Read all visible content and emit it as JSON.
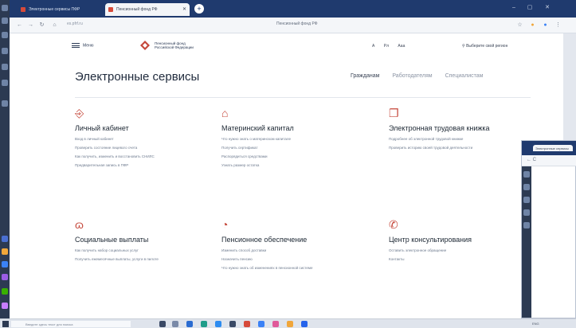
{
  "browser": {
    "tabs": [
      {
        "label": "Электронные сервисы ПФР",
        "active": false
      },
      {
        "label": "Пенсионный фонд РФ",
        "active": true
      }
    ],
    "url": "es.pfrf.ru",
    "page_title": "Пенсионный фонд РФ"
  },
  "site": {
    "menu_label": "Меню",
    "logo_line1": "Пенсионный фонд",
    "logo_line2": "Российской Федерации",
    "header_tools": [
      "А",
      "Рл",
      "Ааа"
    ],
    "region": "Выберите свой регион",
    "heading": "Электронные сервисы",
    "audience_tabs": [
      "Гражданам",
      "Работодателям",
      "Специалистам"
    ]
  },
  "cards": [
    {
      "icon": "personal-cabinet-icon",
      "glyph": "⎆",
      "title": "Личный кабинет",
      "links": [
        "Вход в личный кабинет",
        "Проверить состояние лицевого счета",
        "Как получить, изменить и восстановить СНИЛС",
        "Предварительная запись в ПФР"
      ]
    },
    {
      "icon": "maternity-capital-icon",
      "glyph": "⌂",
      "title": "Материнский капитал",
      "links": [
        "Что нужно знать о материнском капитале",
        "Получить сертификат",
        "Распорядиться средствами",
        "Узнать размер остатка"
      ]
    },
    {
      "icon": "work-book-icon",
      "glyph": "❐",
      "title": "Электронная трудовая книжка",
      "links": [
        "Подробнее об электронной трудовой книжке",
        "Проверить историю своей трудовой деятельности"
      ]
    },
    {
      "icon": "social-payments-icon",
      "glyph": "ɷ",
      "title": "Социальные выплаты",
      "links": [
        "Как получить набор социальных услуг",
        "Получить ежемесячные выплаты, услуги в пилоте"
      ]
    },
    {
      "icon": "pension-icon",
      "glyph": "◔",
      "title": "Пенсионное обеспечение",
      "links": [
        "Изменить способ доставки",
        "Назначить пенсию",
        "Что нужно знать об изменениях в пенсионной системе"
      ]
    },
    {
      "icon": "consulting-center-icon",
      "glyph": "✆",
      "title": "Центр консультирования",
      "links": [
        "Оставить электронное обращение",
        "Контакты"
      ]
    }
  ],
  "taskbar": {
    "search_placeholder": "Введите здесь текст для поиска",
    "tray": "ENG"
  },
  "second_window": {
    "tab_label": "Электронные сервисы",
    "nav": "← С"
  },
  "colors": {
    "accent": "#c5473a",
    "browser_chrome": "#1f3a6e",
    "dock": "#2c3a52"
  }
}
